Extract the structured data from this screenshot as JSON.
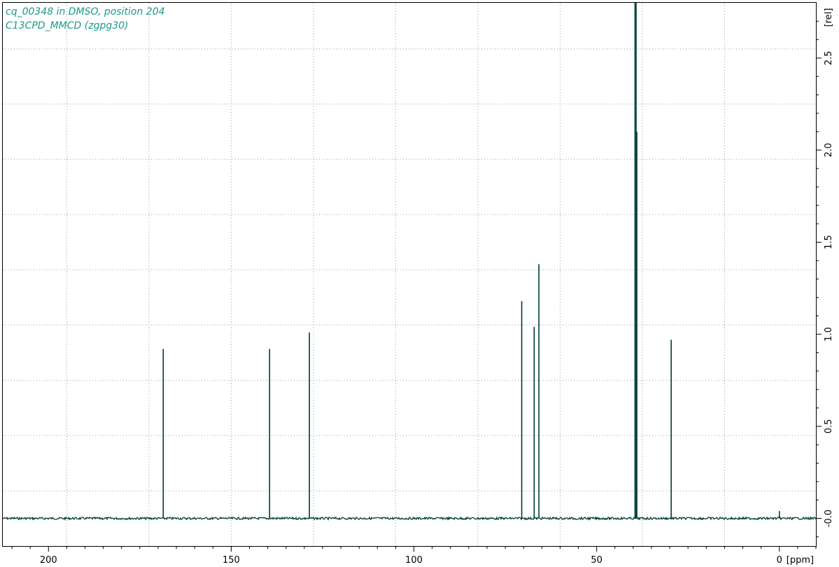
{
  "chart_data": {
    "type": "line",
    "title_lines": [
      "cq_00348 in DMSO, position 204",
      "C13CPD_MMCD (zgpg30)"
    ],
    "xlabel": "[ppm]",
    "ylabel": "[rel]",
    "xlim": [
      212.5,
      -10
    ],
    "ylim": [
      -0.15,
      2.8
    ],
    "x_ticks": [
      200,
      150,
      100,
      50,
      0
    ],
    "x_tick_labels": [
      "200",
      "150",
      "100",
      "50",
      "0"
    ],
    "y_ticks": [
      0.0,
      0.5,
      1.0,
      1.5,
      2.0,
      2.5
    ],
    "y_tick_labels": [
      "-0.0",
      "0.5",
      "1.0",
      "1.5",
      "2.0",
      "2.5"
    ],
    "grid": true,
    "grid_x": [
      195,
      172.5,
      150,
      127.5,
      105,
      82.5,
      60,
      37.5,
      15
    ],
    "grid_y": [
      0.15,
      0.45,
      0.75,
      1.05,
      1.35,
      1.65,
      1.95,
      2.25,
      2.55
    ],
    "color": "#003d36",
    "baseline": 0.0,
    "peaks": [
      {
        "ppm": 168.6,
        "intensity": 0.92
      },
      {
        "ppm": 139.5,
        "intensity": 0.92
      },
      {
        "ppm": 128.6,
        "intensity": 1.01
      },
      {
        "ppm": 70.5,
        "intensity": 1.18
      },
      {
        "ppm": 67.1,
        "intensity": 1.04
      },
      {
        "ppm": 65.8,
        "intensity": 1.38
      },
      {
        "ppm": 39.5,
        "intensity": 2.8
      },
      {
        "ppm": 39.2,
        "intensity": 2.8
      },
      {
        "ppm": 39.0,
        "intensity": 2.1
      },
      {
        "ppm": 29.6,
        "intensity": 0.97
      },
      {
        "ppm": 0.0,
        "intensity": 0.04
      }
    ]
  }
}
